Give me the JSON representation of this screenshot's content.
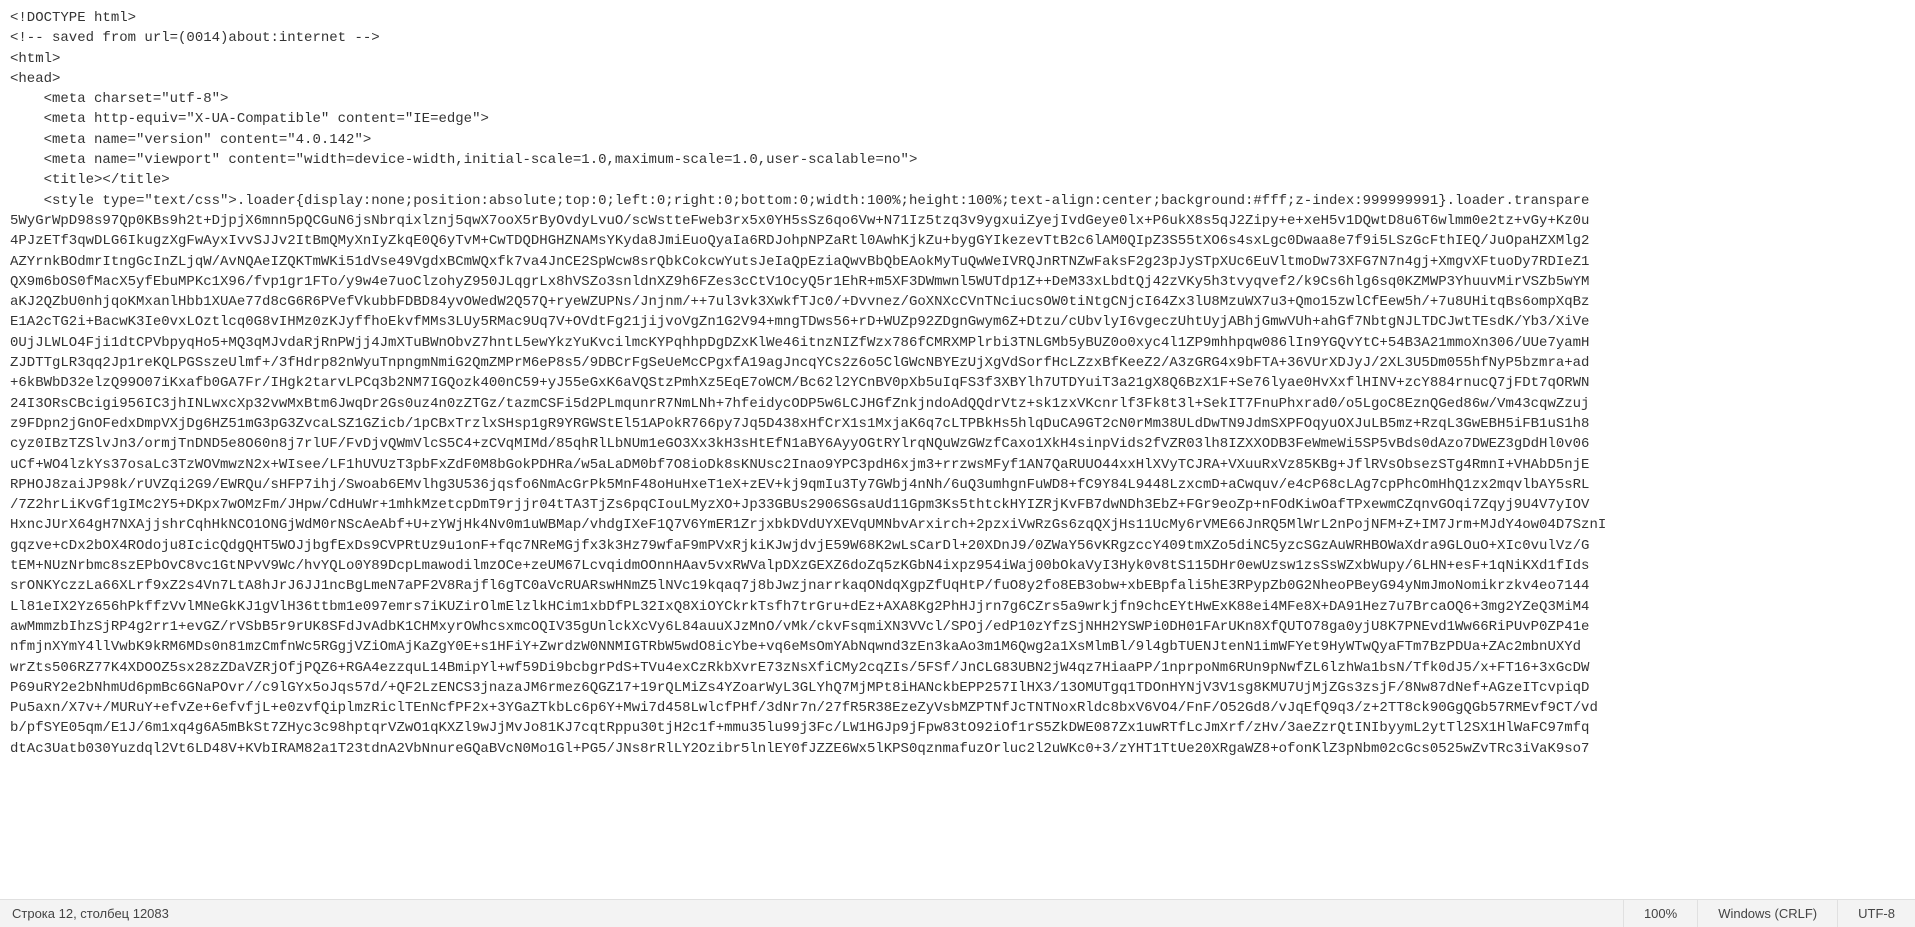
{
  "code_lines": [
    "<!DOCTYPE html>",
    "<!-- saved from url=(0014)about:internet -->",
    "<html>",
    "<head>",
    "    <meta charset=\"utf-8\">",
    "    <meta http-equiv=\"X-UA-Compatible\" content=\"IE=edge\">",
    "    <meta name=\"version\" content=\"4.0.142\">",
    "    <meta name=\"viewport\" content=\"width=device-width,initial-scale=1.0,maximum-scale=1.0,user-scalable=no\">",
    "",
    "    <title></title>",
    "",
    "    <style type=\"text/css\">.loader{display:none;position:absolute;top:0;left:0;right:0;bottom:0;width:100%;height:100%;text-align:center;background:#fff;z-index:999999991}.loader.transpare",
    "5WyGrWpD98s97Qp0KBs9h2t+DjpjX6mnn5pQCGuN6jsNbrqixlznj5qwX7ooX5rByOvdyLvuO/scWstteFweb3rx5x0YH5sSz6qo6Vw+N71Iz5tzq3v9ygxuiZyejIvdGeye0lx+P6ukX8s5qJ2Zipy+e+xeH5v1DQwtD8u6T6wlmm0e2tz+vGy+Kz0u",
    "4PJzETf3qwDLG6IkugzXgFwAyxIvvSJJv2ItBmQMyXnIyZkqE0Q6yTvM+CwTDQDHGHZNAMsYKyda8JmiEuoQyaIa6RDJohpNPZaRtl0AwhKjkZu+bygGYIkezevTtB2c6lAM0QIpZ3S55tXO6s4sxLgc0Dwaa8e7f9i5LSzGcFthIEQ/JuOpaHZXMlg2",
    "AZYrnkBOdmrItngGcInZLjqW/AvNQAeIZQKTmWKi51dVse49VgdxBCmWQxfk7va4JnCE2SpWcw8srQbkCokcwYutsJeIaQpEziaQwvBbQbEAokMyTuQwWeIVRQJnRTNZwFaksF2g23pJySTpXUc6EuVltmoDw73XFG7N7n4gj+XmgvXFtuoDy7RDIeZ1",
    "QX9m6bOS0fMacX5yfEbuMPKc1X96/fvp1gr1FTo/y9w4e7uoClzohyZ950JLqgrLx8hVSZo3snldnXZ9h6FZes3cCtV1OcyQ5r1EhR+m5XF3DWmwnl5WUTdp1Z++DeM33xLbdtQj42zVKy5h3tvyqvef2/k9Cs6hlg6sq0KZMWP3YhuuvMirVSZb5wYM",
    "aKJ2QZbU0nhjqoKMxanlHbb1XUAe77d8cG6R6PVefVkubbFDBD84yvOWedW2Q57Q+ryeWZUPNs/Jnjnm/++7ul3vk3XwkfTJc0/+Dvvnez/GoXNXcCVnTNciucsOW0tiNtgCNjcI64Zx3lU8MzuWX7u3+Qmo15zwlCfEew5h/+7u8UHitqBs6ompXqBz",
    "E1A2cTG2i+BacwK3Ie0vxLOztlcq0G8vIHMz0zKJyffhoEkvfMMs3LUy5RMac9Uq7V+OVdtFg21jijvoVgZn1G2V94+mngTDws56+rD+WUZp92ZDgnGwym6Z+Dtzu/cUbvlyI6vgeczUhtUyjABhjGmwVUh+ahGf7NbtgNJLTDCJwtTEsdK/Yb3/XiVe",
    "0UjJLWLO4Fji1dtCPVbpyqHo5+MQ3qMJvdaRjRnPWjj4JmXTuBWnObvZ7hntL5ewYkzYuKvcilmcKYPqhhpDgDZxKlWe46itnzNIZfWzx786fCMRXMPlrbi3TNLGMb5yBUZ0o0xyc4l1ZP9mhhpqw086lIn9YGQvYtC+54B3A21mmoXn306/UUe7yamH",
    "ZJDTTgLR3qq2Jp1reKQLPGSszeUlmf+/3fHdrp82nWyuTnpngmNmiG2QmZMPrM6eP8s5/9DBCrFgSeUeMcCPgxfA19agJncqYCs2z6o5ClGWcNBYEzUjXgVdSorfHcLZzxBfKeeZ2/A3zGRG4x9bFTA+36VUrXDJyJ/2XL3U5Dm055hfNyP5bzmra+ad",
    "+6kBWbD32elzQ99O07iKxafb0GA7Fr/IHgk2tarvLPCq3b2NM7IGQozk400nC59+yJ55eGxK6aVQStzPmhXz5EqE7oWCM/Bc62l2YCnBV0pXb5uIqFS3f3XBYlh7UTDYuiT3a21gX8Q6BzX1F+Se76lyae0HvXxflHINV+zcY884rnucQ7jFDt7qORWN",
    "24I3ORsCBcigi956IC3jhINLwxcXp32vwMxBtm6JwqDr2Gs0uz4n0zZTGz/tazmCSFi5d2PLmqunrR7NmLNh+7hfeidycODP5w6LCJHGfZnkjndoAdQQdrVtz+sk1zxVKcnrlf3Fk8t3l+SekIT7FnuPhxrad0/o5LgoC8EznQGed86w/Vm43cqwZzuj",
    "z9FDpn2jGnOFedxDmpVXjDg6HZ51mG3pG3ZvcaLSZ1GZicb/1pCBxTrzlxSHsp1gR9YRGWStEl51APokR766py7Jq5D438xHfCrX1s1MxjaK6q7cLTPBkHs5hlqDuCA9GT2cN0rMm38ULdDwTN9JdmSXPFOqyuOXJuLB5mz+RzqL3GwEBH5iFB1uS1h8",
    "cyz0IBzTZSlvJn3/ormjTnDND5e8O60n8j7rlUF/FvDjvQWmVlcS5C4+zCVqMIMd/85qhRlLbNUm1eGO3Xx3kH3sHtEfN1aBY6AyyOGtRYlrqNQuWzGWzfCaxo1XkH4sinpVids2fVZR03lh8IZXXODB3FeWmeWi5SP5vBds0dAzo7DWEZ3gDdHl0v06",
    "uCf+WO4lzkYs37osaLc3TzWOVmwzN2x+WIsee/LF1hUVUzT3pbFxZdF0M8bGokPDHRa/w5aLaDM0bf7O8ioDk8sKNUsc2Inao9YPC3pdH6xjm3+rrzwsMFyf1AN7QaRUUO44xxHlXVyTCJRA+VXuuRxVz85KBg+JflRVsObsezSTg4RmnI+VHAbD5njE",
    "RPHOJ8zaiJP98k/rUVZqi2G9/EWRQu/sHFP7ihj/Swoab6EMvlhg3U536jqsfo6NmAcGrPk5MnF48oHuHxeT1eX+zEV+kj9qmIu3Ty7GWbj4nNh/6uQ3umhgnFuWD8+fC9Y84L9448LzxcmD+aCwquv/e4cP68cLAg7cpPhcOmHhQ1zx2mqvlbAY5sRL",
    "/7Z2hrLiKvGf1gIMc2Y5+DKpx7wOMzFm/JHpw/CdHuWr+1mhkMzetcpDmT9rjjr04tTA3TjZs6pqCIouLMyzXO+Jp33GBUs2906SGsaUd11Gpm3Ks5thtckHYIZRjKvFB7dwNDh3EbZ+FGr9eoZp+nFOdKiwOafTPxewmCZqnvGOqi7Zqyj9U4V7yIOV",
    "HxncJUrX64gH7NXAjjshrCqhHkNCO1ONGjWdM0rNScAeAbf+U+zYWjHk4Nv0m1uWBMap/vhdgIXeF1Q7V6YmER1ZrjxbkDVdUYXEVqUMNbvArxirch+2pzxiVwRzGs6zqQXjHs11UcMy6rVME66JnRQ5MlWrL2nPojNFM+Z+IM7Jrm+MJdY4ow04D7SznI",
    "gqzve+cDx2bOX4ROdoju8IcicQdgQHT5WOJjbgfExDs9CVPRtUz9u1onF+fqc7NReMGjfx3k3Hz79wfaF9mPVxRjkiKJwjdvjE59W68K2wLsCarDl+20XDnJ9/0ZWaY56vKRgzccY409tmXZo5diNC5yzcSGzAuWRHBOWaXdra9GLOuO+XIc0vulVz/G",
    "tEM+NUzNrbmc8szEPbOvC8vc1GtNPvV9Wc/hvYQLo0Y89DcpLmawodilmzOCe+zeUM67LcvqidmOOnnHAav5vxRWValpDXzGEXZ6doZq5zKGbN4ixpz954iWaj00bOkaVyI3Hyk0v8tS115DHr0ewUzsw1zsSsWZxbWupy/6LHN+esF+1qNiKXd1fIds",
    "srONKYczzLa66XLrf9xZ2s4Vn7LtA8hJrJ6JJ1ncBgLmeN7aPF2V8Rajfl6gTC0aVcRUARswHNmZ5lNVc19kqaq7j8bJwzjnarrkaqONdqXgpZfUqHtP/fuO8y2fo8EB3obw+xbEBpfali5hE3RPypZb0G2NheoPBeyG94yNmJmoNomikrzkv4eo7144",
    "Ll81eIX2Yz656hPkffzVvlMNeGkKJ1gVlH36ttbm1e097emrs7iKUZirOlmElzlkHCim1xbDfPL32IxQ8XiOYCkrkTsfh7trGru+dEz+AXA8Kg2PhHJjrn7g6CZrs5a9wrkjfn9chcEYtHwExK88ei4MFe8X+DA91Hez7u7BrcaOQ6+3mg2YZeQ3MiM4",
    "awMmmzbIhzSjRP4g2rr1+evGZ/rVSbB5r9rUK8SFdJvAdbK1CHMxyrOWhcsxmcOQIV35gUnlckXcVy6L84auuXJzMnO/vMk/ckvFsqmiXN3VVcl/SPOj/edP10zYfzSjNHH2YSWPi0DH01FArUKn8XfQUTO78ga0yjU8K7PNEvd1Ww66RiPUvP0ZP41e",
    "nfmjnXYmY4llVwbK9kRM6MDs0n81mzCmfnWc5RGgjVZiOmAjKaZgY0E+s1HFiY+ZwrdzW0NNMIGTRbW5wdO8icYbe+vq6eMsOmYAbNqwnd3zEn3kaAo3m1M6Qwg2a1XsMlmBl/9l4gbTUENJtenN1imWFYet9HyWTwQyaFTm7BzPDUa+ZAc2mbnUXYd",
    "wrZts506RZ77K4XDOOZ5sx28zZDaVZRjOfjPQZ6+RGA4ezzquL14BmipYl+wf59Di9bcbgrPdS+TVu4exCzRkbXvrE73zNsXfiCMy2cqZIs/5FSf/JnCLG83UBN2jW4qz7HiaaPP/1nprpoNm6RUn9pNwfZL6lzhWa1bsN/Tfk0dJ5/x+FT16+3xGcDW",
    "P69uRY2e2bNhmUd6pmBc6GNaPOvr//c9lGYx5oJqs57d/+QF2LzENCS3jnazaJM6rmez6QGZ17+19rQLMiZs4YZoarWyL3GLYhQ7MjMPt8iHANckbEPP257IlHX3/13OMUTgq1TDOnHYNjV3V1sg8KMU7UjMjZGs3zsjF/8Nw87dNef+AGzeITcvpiqD",
    "Pu5axn/X7v+/MURuY+efvZe+6efvfjL+e0zvfQiplmzRiclTEnNcfPF2x+3YGaZTkbLc6p6Y+Mwi7d458LwlcfPHf/3dNr7n/27fR5R38EzeZyVsbMZPTNfJcTNTNoxRldc8bxV6VO4/FnF/O52Gd8/vJqEfQ9q3/z+2TT8ck90GgQGb57RMEvf9CT/vd",
    "b/pfSYE05qm/E1J/6m1xq4g6A5mBkSt7ZHyc3c98hptqrVZwO1qKXZl9wJjMvJo81KJ7cqtRppu30tjH2c1f+mmu35lu99j3Fc/LW1HGJp9jFpw83tO92iOf1rS5ZkDWE087Zx1uwRTfLcJmXrf/zHv/3aeZzrQtINIbyymL2ytTl2SX1HlWaFC97mfq",
    "dtAc3Uatb030Yuzdql2Vt6LD48V+KVbIRAM82a1T23tdnA2VbNnureGQaBVcN0Mo1Gl+PG5/JNs8rRlLY2Ozibr5lnlEY0fJZZE6Wx5lKPS0qznmafuzOrluc2l2uWKc0+3/zYHT1TtUe20XRgaWZ8+ofonKlZ3pNbm02cGcs0525wZvTRc3iVaK9so7"
  ],
  "status": {
    "cursor": "Строка 12, столбец 12083",
    "zoom": "100%",
    "eol": "Windows (CRLF)",
    "encoding": "UTF-8"
  }
}
